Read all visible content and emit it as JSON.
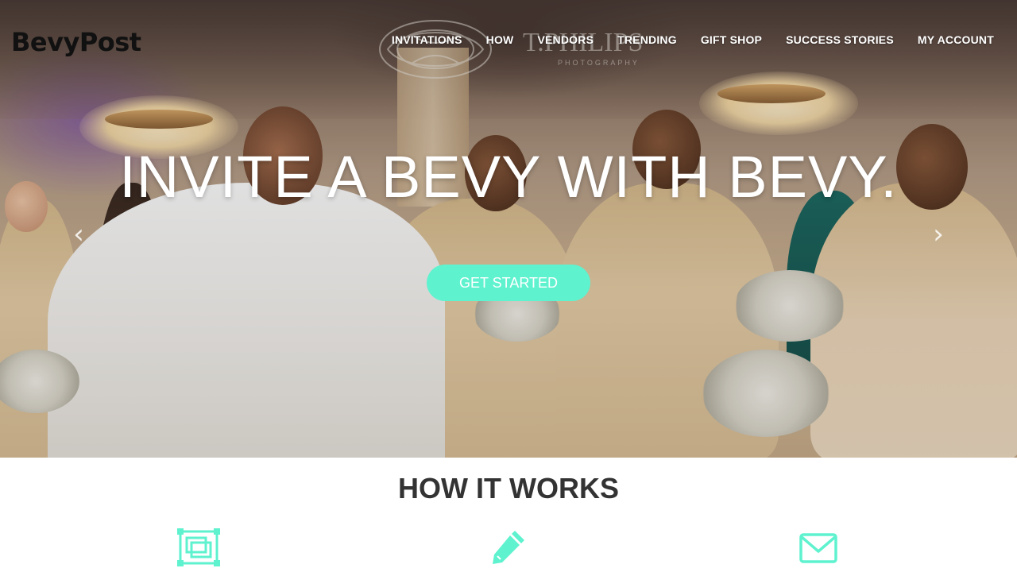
{
  "brand": {
    "name": "BevyPost"
  },
  "nav": {
    "items": [
      {
        "label": "INVITATIONS"
      },
      {
        "label": "HOW"
      },
      {
        "label": "VENDORS"
      },
      {
        "label": "TRENDING"
      },
      {
        "label": "GIFT SHOP"
      },
      {
        "label": "SUCCESS STORIES"
      },
      {
        "label": "MY ACCOUNT"
      }
    ]
  },
  "hero": {
    "headline": "INVITE A BEVY WITH BEVY.",
    "cta_label": "GET STARTED",
    "image_watermark_text": "T.PHILIPS PHOTOGRAPHY",
    "prev_icon": "chevron-left-icon",
    "next_icon": "chevron-right-icon"
  },
  "how_it_works": {
    "title": "HOW IT WORKS",
    "steps": [
      {
        "icon": "template-icon"
      },
      {
        "icon": "pencil-icon"
      },
      {
        "icon": "envelope-icon"
      }
    ]
  },
  "colors": {
    "accent": "#5ff2cf",
    "text_dark": "#333333",
    "logo": "#111111",
    "white": "#ffffff"
  }
}
